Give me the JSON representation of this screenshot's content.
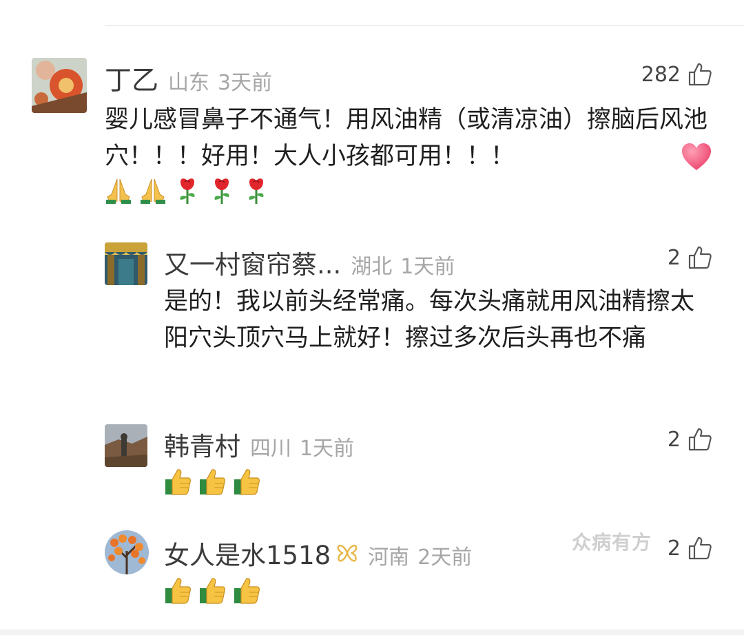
{
  "comments": [
    {
      "name": "丁乙",
      "location": "山东",
      "time": "3天前",
      "likes": "282",
      "text": "婴儿感冒鼻子不通气！用风油精（或清凉油）擦脑后风池穴！！！好用！大人小孩都可用！！！",
      "emojis": [
        "heart-icon",
        "pray-icon",
        "pray-icon",
        "rose-icon",
        "rose-icon",
        "rose-icon"
      ]
    },
    {
      "name": "又一村窗帘蔡...",
      "location": "湖北",
      "time": "1天前",
      "likes": "2",
      "text": "是的！我以前头经常痛。每次头痛就用风油精擦太阳穴头顶穴马上就好！擦过多次后头再也不痛"
    },
    {
      "name": "韩青村",
      "location": "四川",
      "time": "1天前",
      "likes": "2",
      "emojis": [
        "thumbs-up-icon",
        "thumbs-up-icon",
        "thumbs-up-icon"
      ]
    },
    {
      "name": "女人是水1518",
      "location": "河南",
      "time": "2天前",
      "likes": "2",
      "emojis": [
        "thumbs-up-icon",
        "thumbs-up-icon",
        "thumbs-up-icon"
      ]
    }
  ],
  "watermark": "众病有方",
  "colors": {
    "meta_gray": "#a6a6a6",
    "badge_gold": "#e8b84a"
  }
}
